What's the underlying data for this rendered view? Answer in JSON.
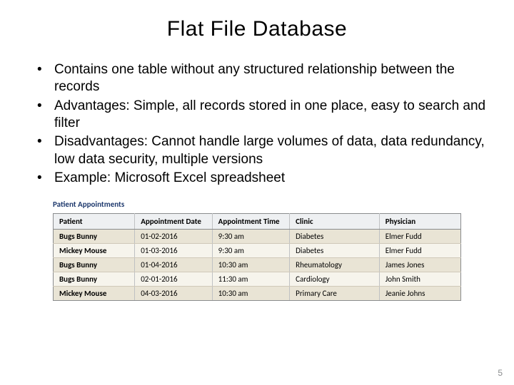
{
  "title": "Flat File Database",
  "bullets": [
    "Contains one table without any structured relationship between the records",
    "Advantages: Simple, all records stored in one place, easy to search and filter",
    "Disadvantages: Cannot handle large volumes of data, data redundancy, low data security, multiple versions",
    "Example: Microsoft Excel spreadsheet"
  ],
  "table": {
    "caption": "Patient Appointments",
    "headers": [
      "Patient",
      "Appointment Date",
      "Appointment Time",
      "Clinic",
      "Physician"
    ],
    "rows": [
      [
        "Bugs Bunny",
        "01-02-2016",
        "9:30 am",
        "Diabetes",
        "Elmer Fudd"
      ],
      [
        "Mickey Mouse",
        "01-03-2016",
        "9:30 am",
        "Diabetes",
        "Elmer Fudd"
      ],
      [
        "Bugs Bunny",
        "01-04-2016",
        "10:30 am",
        "Rheumatology",
        "James Jones"
      ],
      [
        "Bugs Bunny",
        "02-01-2016",
        "11:30 am",
        "Cardiology",
        "John Smith"
      ],
      [
        "Mickey Mouse",
        "04-03-2016",
        "10:30 am",
        "Primary Care",
        "Jeanie Johns"
      ]
    ]
  },
  "page_number": "5"
}
